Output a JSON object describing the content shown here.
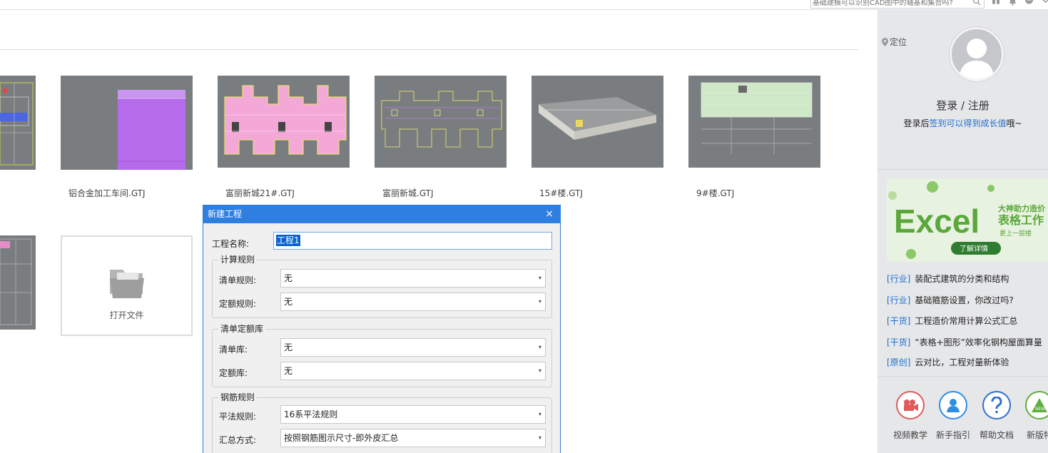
{
  "topbar": {
    "search_placeholder": "基础建模可以识别CAD图中的轴基和集合吗?"
  },
  "projects": [
    {
      "name": "铝合金加工车间.GTJ"
    },
    {
      "name": "富丽新城21#.GTJ"
    },
    {
      "name": "富丽新城.GTJ"
    },
    {
      "name": "15#楼.GTJ"
    },
    {
      "name": "9#楼.GTJ"
    }
  ],
  "open_file": {
    "label": "打开文件"
  },
  "dialog": {
    "title": "新建工程",
    "close": "×",
    "project_name_label": "工程名称:",
    "project_name_value": "工程1",
    "calc_rules": {
      "title": "计算规则",
      "list_rule_label": "清单规则:",
      "list_rule_value": "无",
      "quota_rule_label": "定额规则:",
      "quota_rule_value": "无"
    },
    "library": {
      "title": "清单定额库",
      "list_lib_label": "清单库:",
      "list_lib_value": "无",
      "quota_lib_label": "定额库:",
      "quota_lib_value": "无"
    },
    "rebar": {
      "title": "钢筋规则",
      "flat_rule_label": "平法规则:",
      "flat_rule_value": "16系平法规则",
      "summary_label": "汇总方式:",
      "summary_value": "按照钢筋图示尺寸-即外皮汇总"
    }
  },
  "sidebar": {
    "location": "定位",
    "login": "登录 / 注册",
    "hint_pre": "登录后",
    "hint_link": "签到可以得到成长值",
    "hint_post": "哦~",
    "banner": {
      "big": "Excel",
      "line1": "大神助力造价",
      "line2": "表格工作",
      "line3": "更上一层楼",
      "button": "了解详情"
    },
    "news": [
      {
        "tag": "[行业]",
        "text": "装配式建筑的分类和结构"
      },
      {
        "tag": "[行业]",
        "text": "基础箍筋设置，你改过吗?"
      },
      {
        "tag": "[干货]",
        "text": "工程造价常用计算公式汇总"
      },
      {
        "tag": "[干货]",
        "text": "“表格+图形”效率化钢构屋面算量"
      },
      {
        "tag": "[原创]",
        "text": "云对比，工程对量新体验"
      }
    ],
    "tools": [
      {
        "label": "视频教学",
        "icon": "video-camera-icon",
        "color": "#e05a5a"
      },
      {
        "label": "新手指引",
        "icon": "user-guide-icon",
        "color": "#2e8ee0"
      },
      {
        "label": "帮助文档",
        "icon": "help-question-icon",
        "color": "#2e6fd0"
      },
      {
        "label": "新版特",
        "icon": "new-version-icon",
        "color": "#5fae3c"
      }
    ]
  }
}
